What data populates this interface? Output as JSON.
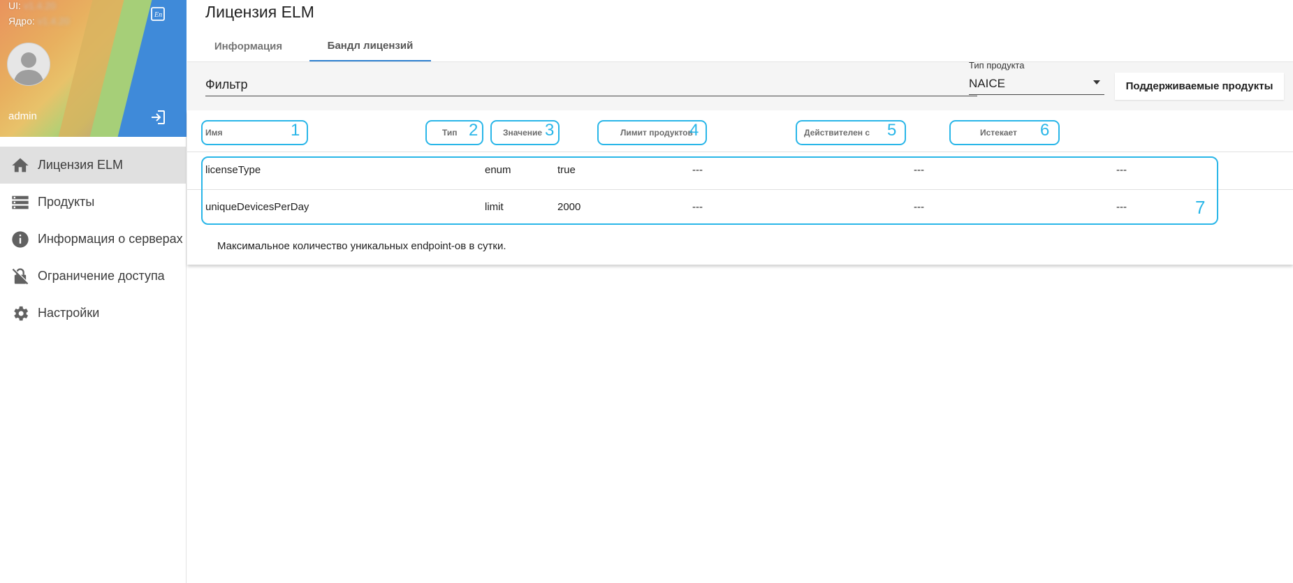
{
  "sidebar": {
    "version_ui_label": "UI:",
    "version_ui_value": "v1.4.20",
    "version_core_label": "Ядро:",
    "version_core_value": "v1.4.20",
    "username": "admin",
    "icons": {
      "language": "language-icon",
      "logout": "logout-icon",
      "avatar": "avatar-icon"
    },
    "items": [
      {
        "label": "Лицензия ELM",
        "icon": "home-icon",
        "active": true
      },
      {
        "label": "Продукты",
        "icon": "list-icon",
        "active": false
      },
      {
        "label": "Информация о серверах",
        "icon": "info-icon",
        "active": false
      },
      {
        "label": "Ограничение доступа",
        "icon": "lock-icon",
        "active": false
      },
      {
        "label": "Настройки",
        "icon": "gear-icon",
        "active": false
      }
    ]
  },
  "main": {
    "title": "Лицензия ELM",
    "tabs": [
      {
        "label": "Информация",
        "active": false
      },
      {
        "label": "Бандл лицензий",
        "active": true
      }
    ],
    "filter": {
      "placeholder": "Фильтр",
      "value": ""
    },
    "product_type": {
      "label": "Тип продукта",
      "value": "NAICE"
    },
    "supported_button": "Поддерживаемые продукты",
    "table": {
      "columns": [
        {
          "label": "Имя",
          "marker": "1"
        },
        {
          "label": "Тип",
          "marker": "2"
        },
        {
          "label": "Значение",
          "marker": "3"
        },
        {
          "label": "Лимит продуктов",
          "marker": "4"
        },
        {
          "label": "Действителен с",
          "marker": "5"
        },
        {
          "label": "Истекает",
          "marker": "6"
        }
      ],
      "rows": [
        {
          "name": "licenseType",
          "type": "enum",
          "value": "true",
          "limit": "---",
          "valid_from": "---",
          "expires": "---"
        },
        {
          "name": "uniqueDevicesPerDay",
          "type": "limit",
          "value": "2000",
          "limit": "---",
          "valid_from": "---",
          "expires": "---"
        }
      ],
      "rows_marker": "7",
      "description": "Максимальное количество уникальных endpoint-ов в сутки."
    }
  },
  "colors": {
    "accent": "#2f80d0",
    "annotation": "#29b6e8",
    "active_nav_bg": "#e0e0e0"
  }
}
